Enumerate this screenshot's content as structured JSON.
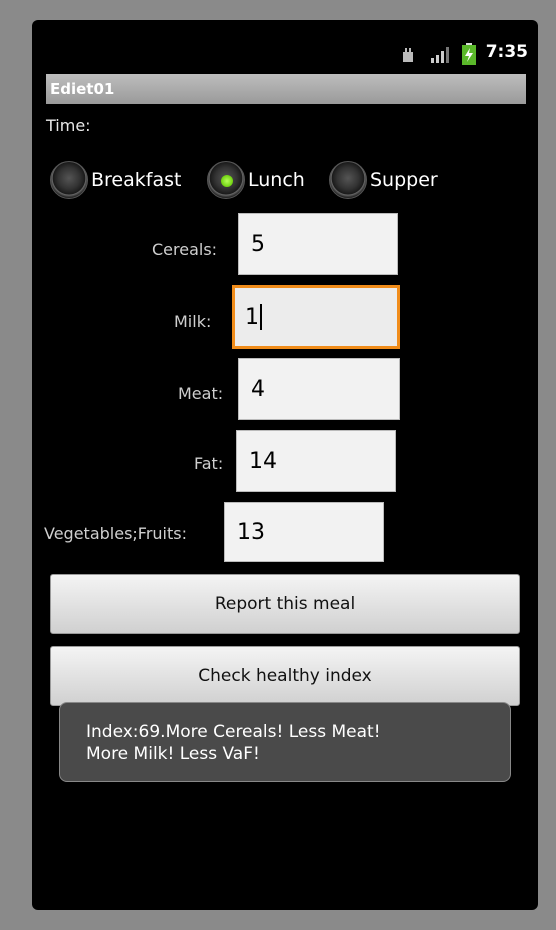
{
  "status_bar": {
    "time": "7:35",
    "icons": [
      "usb-debug-icon",
      "signal-icon",
      "battery-charging-icon"
    ]
  },
  "app": {
    "title": "Ediet01"
  },
  "form": {
    "time_label": "Time:",
    "meal_options": [
      {
        "label": "Breakfast",
        "checked": false
      },
      {
        "label": "Lunch",
        "checked": true
      },
      {
        "label": "Supper",
        "checked": false
      }
    ],
    "fields": {
      "cereals": {
        "label": "Cereals:",
        "value": "5"
      },
      "milk": {
        "label": "Milk:",
        "value": "1"
      },
      "meat": {
        "label": "Meat:",
        "value": "4"
      },
      "fat": {
        "label": "Fat:",
        "value": "14"
      },
      "veg_fruits": {
        "label": "Vegetables;Fruits:",
        "value": "13"
      }
    },
    "report_button": "Report this meal",
    "check_button": "Check healthy index"
  },
  "toast": {
    "line1": "Index:69.More Cereals! Less Meat!",
    "line2": "More Milk! Less VaF!"
  },
  "colors": {
    "focus_border": "#f08c1a",
    "radio_checked": "#6fd10f"
  }
}
